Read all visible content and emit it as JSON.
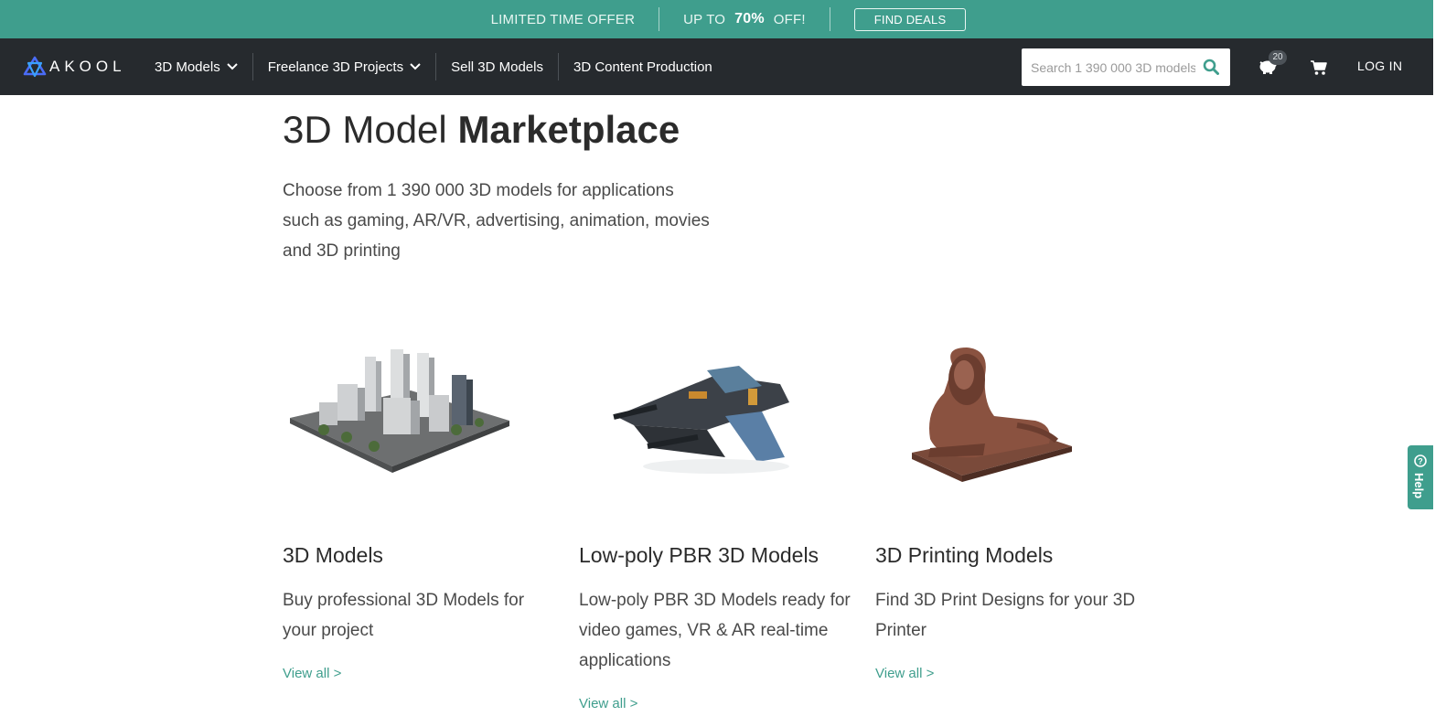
{
  "promo": {
    "offer_label": "LIMITED TIME OFFER",
    "up_to": "UP TO",
    "percent": "70%",
    "off": "OFF!",
    "button_label": "FIND DEALS",
    "color": "#3f9e8d"
  },
  "nav": {
    "logo_text": "AKOOL",
    "menu": [
      {
        "label": "3D Models",
        "has_dropdown": true
      },
      {
        "label": "Freelance 3D Projects",
        "has_dropdown": true
      },
      {
        "label": "Sell 3D Models",
        "has_dropdown": false
      },
      {
        "label": "3D Content Production",
        "has_dropdown": false
      }
    ],
    "search_placeholder": "Search 1 390 000 3D models",
    "piggy_badge": "20",
    "login_label": "LOG IN",
    "background": "#262a2e"
  },
  "hero": {
    "title_light": "3D Model",
    "title_bold": "Marketplace",
    "intro": "Choose from 1 390 000 3D models for applications such as gaming, AR/VR, advertising, animation, movies and 3D printing"
  },
  "cards": [
    {
      "title": "3D Models",
      "description": "Buy professional 3D Models for your project",
      "link": "View all >",
      "image_icon": "city-model-icon"
    },
    {
      "title": "Low-poly PBR 3D Models",
      "description": "Low-poly PBR 3D Models ready for video games, VR & AR real-time applications",
      "link": "View all >",
      "image_icon": "spaceship-model-icon"
    },
    {
      "title": "3D Printing Models",
      "description": "Find 3D Print Designs for your 3D Printer",
      "link": "View all >",
      "image_icon": "lion-statue-icon"
    }
  ],
  "help": {
    "label": "Help"
  },
  "icons": {
    "search": "search-icon",
    "piggy": "piggy-bank-icon",
    "cart": "cart-icon",
    "chevron": "chevron-down-icon"
  }
}
